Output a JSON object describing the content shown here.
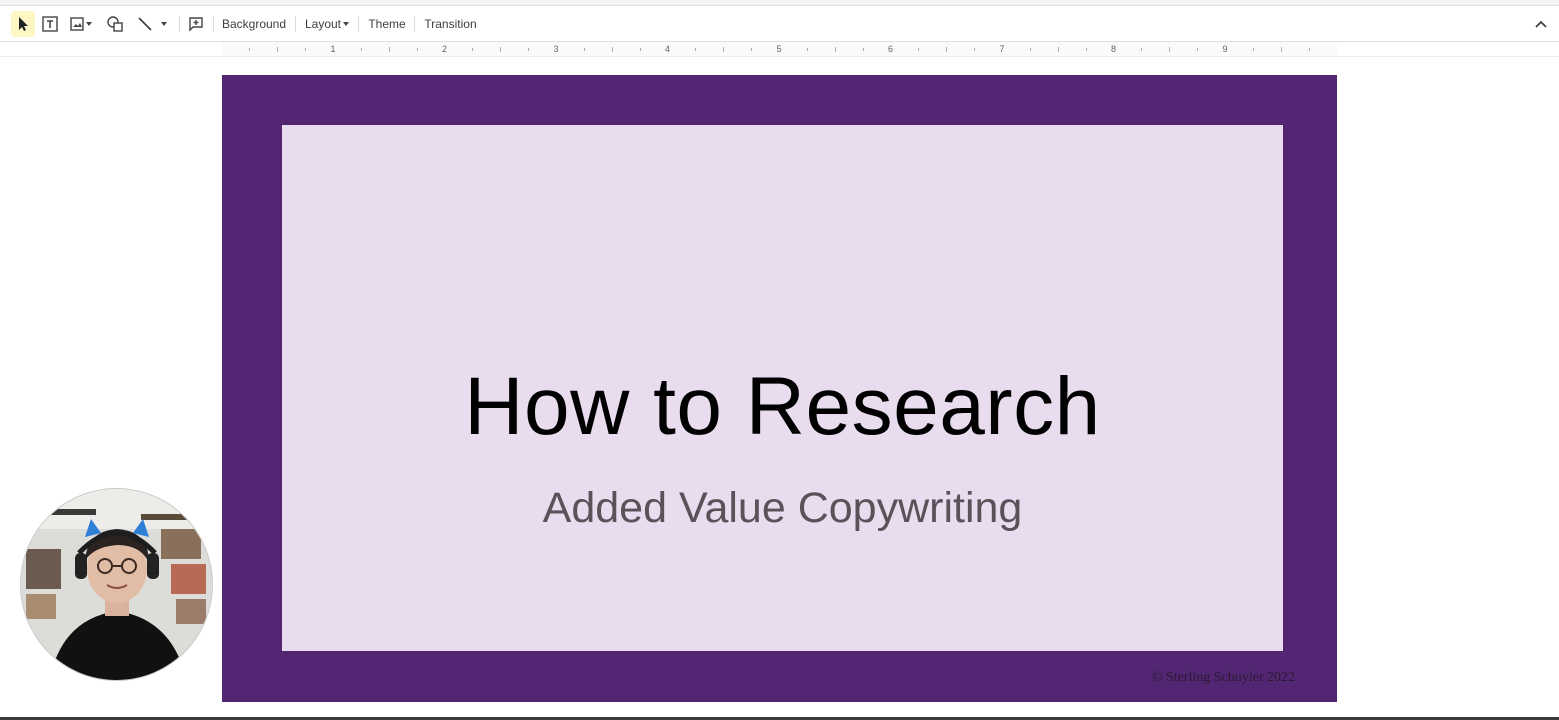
{
  "toolbar": {
    "tools": [
      {
        "name": "select-tool",
        "icon": "cursor-arrow-icon"
      },
      {
        "name": "textbox-tool",
        "icon": "text-box-icon"
      },
      {
        "name": "image-tool",
        "icon": "image-icon"
      },
      {
        "name": "shape-tool",
        "icon": "shapes-icon"
      },
      {
        "name": "line-tool",
        "icon": "line-icon"
      },
      {
        "name": "comment-tool",
        "icon": "add-comment-icon"
      }
    ],
    "background_label": "Background",
    "layout_label": "Layout",
    "theme_label": "Theme",
    "transition_label": "Transition",
    "collapse_icon": "chevron-up-icon"
  },
  "ruler": {
    "numbers": [
      "1",
      "2",
      "3",
      "4",
      "5",
      "6",
      "7",
      "8",
      "9"
    ]
  },
  "slide": {
    "title": "How to Research",
    "subtitle": "Added Value Copywriting",
    "copyright": "© Sterling Schuyler 2022",
    "frame_color": "#522672",
    "panel_color": "#e8dcee"
  },
  "webcam": {
    "icon": "webcam-person-image"
  }
}
